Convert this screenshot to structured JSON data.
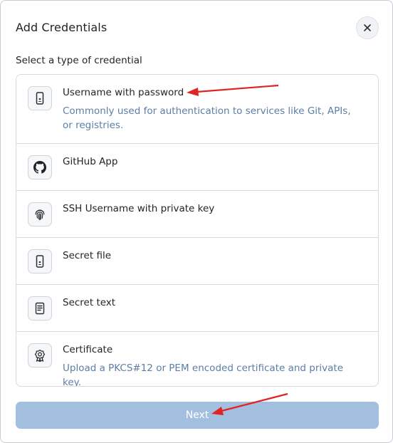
{
  "dialog": {
    "title": "Add Credentials",
    "close_icon": "close-icon"
  },
  "section_label": "Select a type of credential",
  "credential_types": [
    {
      "title": "Username with password",
      "description": "Commonly used for authentication to services like Git, APIs, or registries.",
      "icon": "mobile-device-icon"
    },
    {
      "title": "GitHub App",
      "description": "",
      "icon": "github-icon"
    },
    {
      "title": "SSH Username with private key",
      "description": "",
      "icon": "fingerprint-icon"
    },
    {
      "title": "Secret file",
      "description": "",
      "icon": "mobile-device-icon"
    },
    {
      "title": "Secret text",
      "description": "",
      "icon": "document-icon"
    },
    {
      "title": "Certificate",
      "description": "Upload a PKCS#12 or PEM encoded certificate and private key.",
      "icon": "certificate-badge-icon"
    }
  ],
  "next_button": "Next",
  "colors": {
    "accent_disabled": "#a3bfe0",
    "description_text": "#5b7ea6",
    "annotation_arrow": "#e02424"
  }
}
